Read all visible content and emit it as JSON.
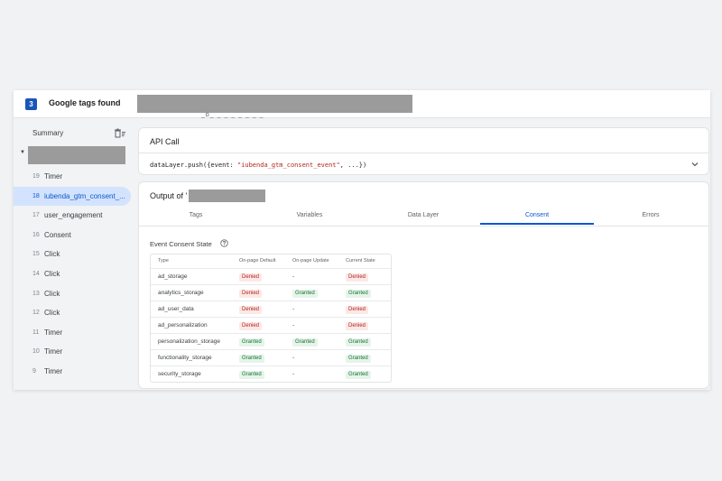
{
  "topbar": {
    "count": "3",
    "title": "Google tags found",
    "fragment": "_ɒ_ _ _ _ _ _ _ _"
  },
  "sidebar": {
    "summary_label": "Summary",
    "items": [
      {
        "num": "19",
        "label": "Timer"
      },
      {
        "num": "18",
        "label": "iubenda_gtm_consent_...",
        "selected": true
      },
      {
        "num": "17",
        "label": "user_engagement"
      },
      {
        "num": "16",
        "label": "Consent"
      },
      {
        "num": "15",
        "label": "Click"
      },
      {
        "num": "14",
        "label": "Click"
      },
      {
        "num": "13",
        "label": "Click"
      },
      {
        "num": "12",
        "label": "Click"
      },
      {
        "num": "11",
        "label": "Timer"
      },
      {
        "num": "10",
        "label": "Timer"
      },
      {
        "num": "9",
        "label": "Timer"
      }
    ]
  },
  "api_call": {
    "title": "API Call",
    "code_prefix": "dataLayer.push({event: ",
    "code_string": "\"iubenda_gtm_consent_event\"",
    "code_suffix": ", ...})"
  },
  "output": {
    "title": "Output of",
    "title_suffix": "'",
    "tabs": [
      "Tags",
      "Variables",
      "Data Layer",
      "Consent",
      "Errors"
    ],
    "active_tab": "Consent"
  },
  "consent": {
    "section_label": "Event Consent State",
    "headers": [
      "Type",
      "On-page Default",
      "On-page Update",
      "Current State"
    ],
    "rows": [
      {
        "type": "ad_storage",
        "default": "Denied",
        "update": "-",
        "current": "Denied"
      },
      {
        "type": "analytics_storage",
        "default": "Denied",
        "update": "Granted",
        "current": "Granted"
      },
      {
        "type": "ad_user_data",
        "default": "Denied",
        "update": "-",
        "current": "Denied"
      },
      {
        "type": "ad_personalization",
        "default": "Denied",
        "update": "-",
        "current": "Denied"
      },
      {
        "type": "personalization_storage",
        "default": "Granted",
        "update": "Granted",
        "current": "Granted"
      },
      {
        "type": "functionality_storage",
        "default": "Granted",
        "update": "-",
        "current": "Granted"
      },
      {
        "type": "security_storage",
        "default": "Granted",
        "update": "-",
        "current": "Granted"
      }
    ]
  },
  "colors": {
    "accent": "#0b57d0",
    "denied": "#b3261e",
    "granted": "#137333",
    "badge": "#1a56b8"
  },
  "icons": {
    "delete": "delete-sweep-icon",
    "chevron": "chevron-down-icon",
    "help": "help-circle-icon",
    "caret": "caret-down-icon"
  }
}
